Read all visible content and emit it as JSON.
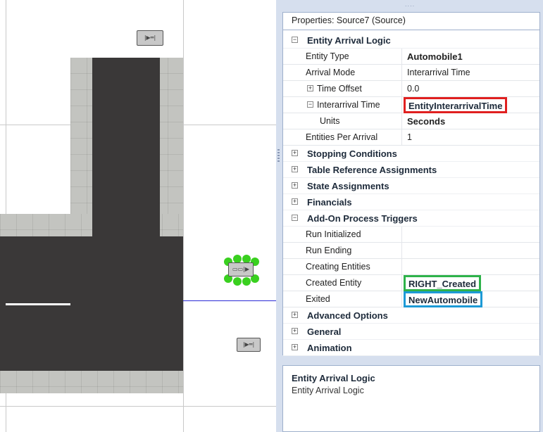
{
  "panel": {
    "title": "Properties: Source7 (Source)",
    "grip": "...."
  },
  "canvas": {
    "node_top_label": "|▶═|",
    "node_selected_label": "▭▭|▶",
    "node_bottom_label": "|▶═|"
  },
  "categories": {
    "entity_arrival_logic": {
      "label": "Entity Arrival Logic",
      "expander": "−"
    },
    "stopping_conditions": {
      "label": "Stopping Conditions",
      "expander": "+"
    },
    "table_reference_assignments": {
      "label": "Table Reference Assignments",
      "expander": "+"
    },
    "state_assignments": {
      "label": "State Assignments",
      "expander": "+"
    },
    "financials": {
      "label": "Financials",
      "expander": "+"
    },
    "add_on_process_triggers": {
      "label": "Add-On Process Triggers",
      "expander": "−"
    },
    "advanced_options": {
      "label": "Advanced Options",
      "expander": "+"
    },
    "general": {
      "label": "General",
      "expander": "+"
    },
    "animation": {
      "label": "Animation",
      "expander": "+"
    }
  },
  "properties": {
    "entity_type": {
      "name": "Entity Type",
      "value": "Automobile1"
    },
    "arrival_mode": {
      "name": "Arrival Mode",
      "value": "Interarrival Time"
    },
    "time_offset": {
      "name": "Time Offset",
      "value": "0.0",
      "expander": "+"
    },
    "interarrival_time": {
      "name": "Interarrival Time",
      "value": "EntityInterarrivalTime",
      "expander": "−"
    },
    "units": {
      "name": "Units",
      "value": "Seconds"
    },
    "entities_per_arrival": {
      "name": "Entities Per Arrival",
      "value": "1"
    },
    "run_initialized": {
      "name": "Run Initialized",
      "value": ""
    },
    "run_ending": {
      "name": "Run Ending",
      "value": ""
    },
    "creating_entities": {
      "name": "Creating Entities",
      "value": ""
    },
    "created_entity": {
      "name": "Created Entity",
      "value": "RIGHT_Created"
    },
    "exited": {
      "name": "Exited",
      "value": "NewAutomobile"
    }
  },
  "help": {
    "title": "Entity Arrival Logic",
    "text": "Entity Arrival Logic"
  },
  "colors": {
    "highlight_red": "#e02020",
    "highlight_green": "#2eb24a",
    "highlight_blue": "#1d9ad6",
    "selection_green": "#39d01f",
    "path_blue": "#2b2bd6"
  }
}
